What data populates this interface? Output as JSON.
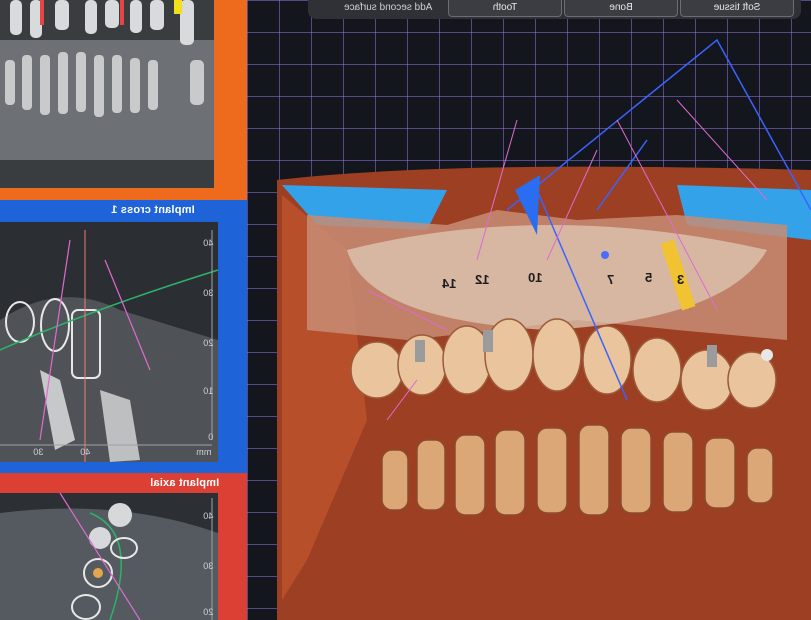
{
  "toolbar": {
    "add_second_surface": "Add second surface",
    "buttons": [
      "Tooth",
      "Bone",
      "Soft tissue"
    ]
  },
  "panels": {
    "cross": {
      "title": "Implant cross 1",
      "scale": [
        "40",
        "30",
        "20",
        "10",
        "0"
      ],
      "bottom_ticks": [
        "30",
        "40"
      ],
      "unit": "mm"
    },
    "axial": {
      "title": "Implant axial",
      "scale": [
        "40",
        "30",
        "20"
      ]
    }
  },
  "tooth_numbers": [
    "14",
    "12",
    "10",
    "7",
    "5",
    "3"
  ],
  "colors": {
    "orange_frame": "#ee6a1c",
    "blue_frame": "#1f63d8",
    "red_frame": "#dc3f33",
    "grid": "#9a7cf0"
  }
}
